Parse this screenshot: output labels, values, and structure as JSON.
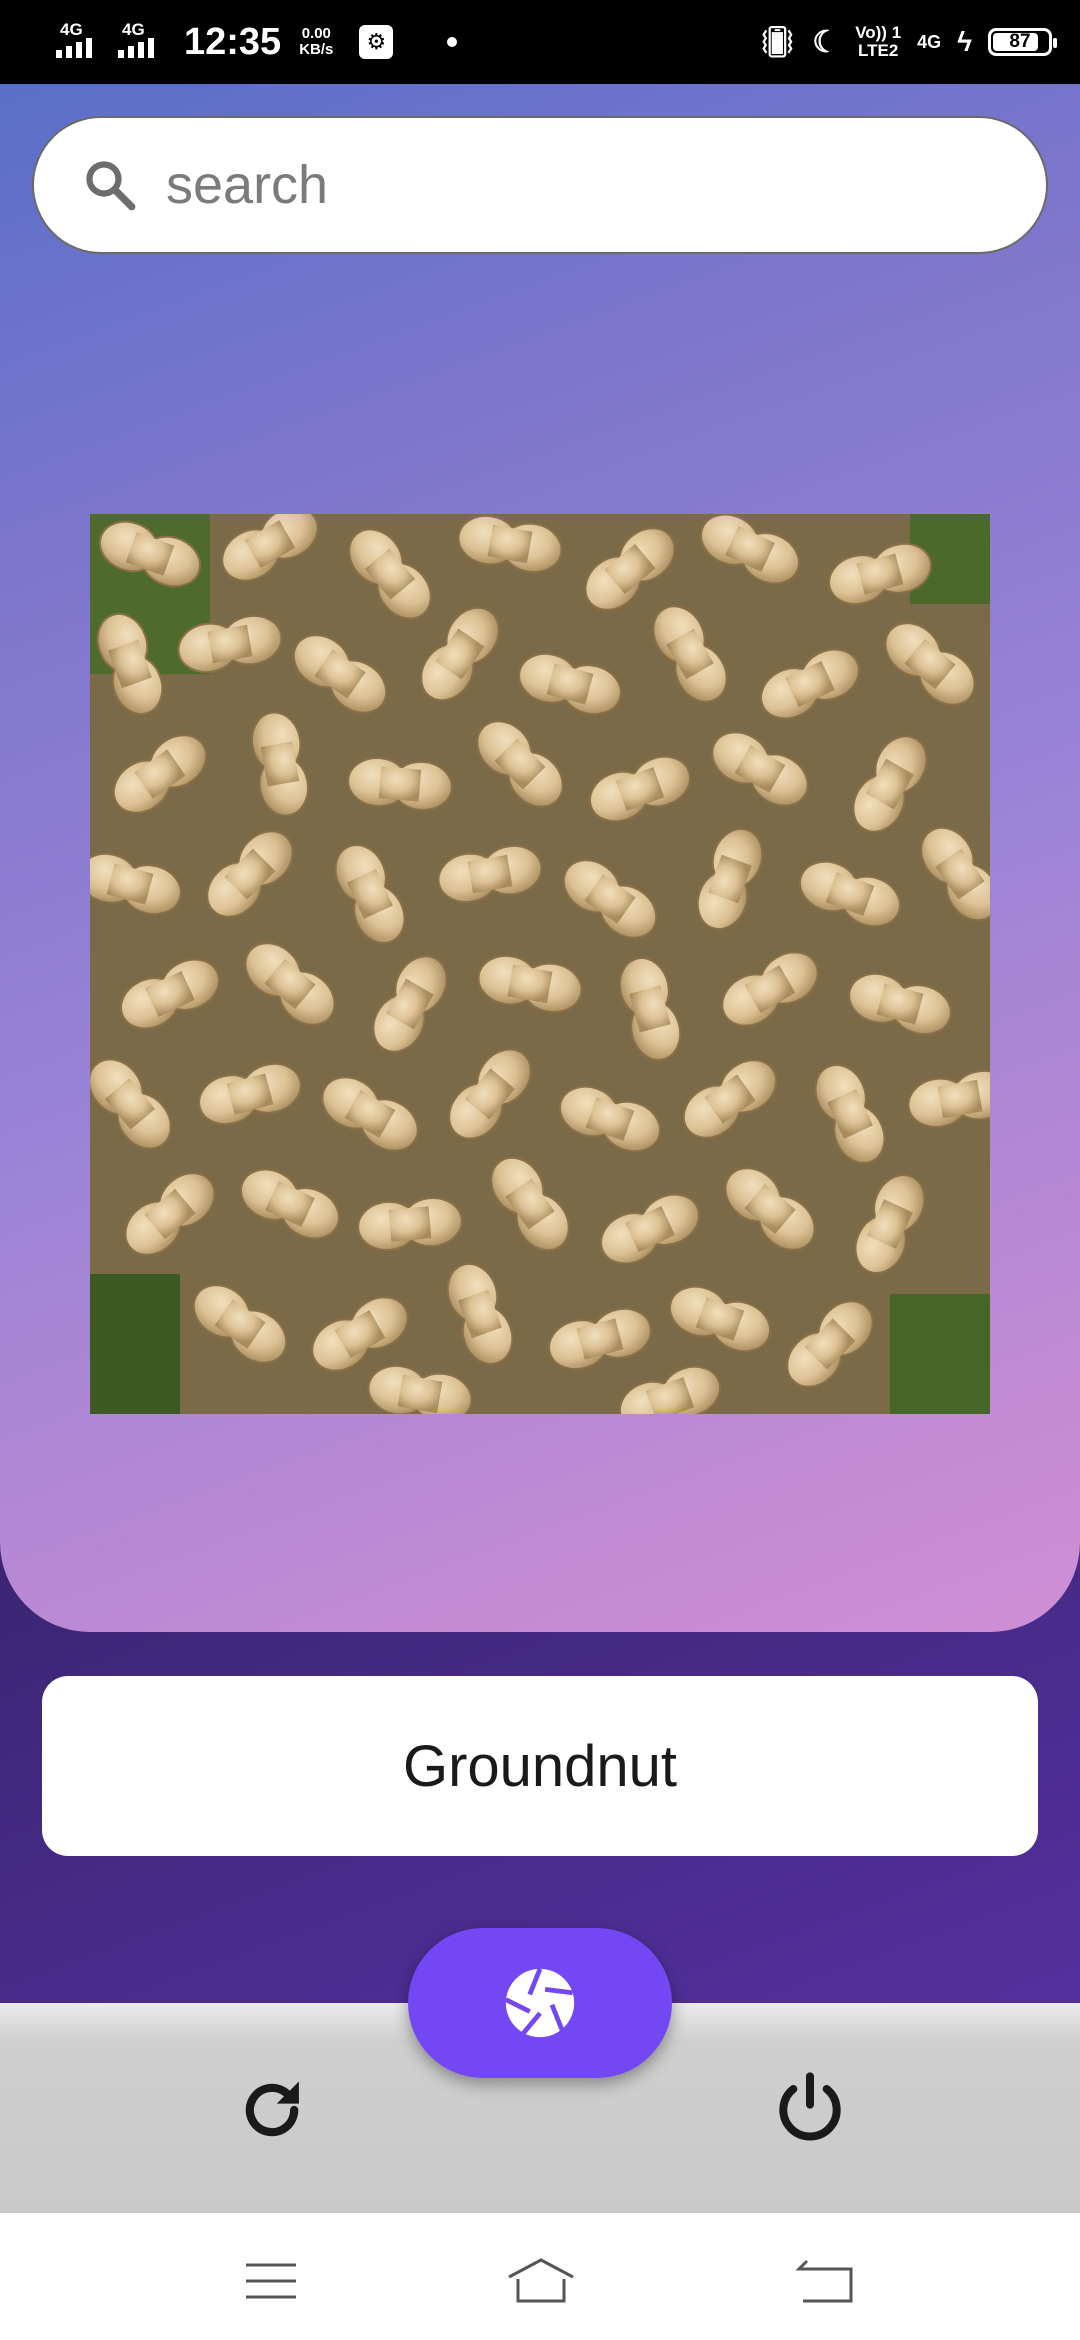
{
  "status_bar": {
    "network1": "4G",
    "network2": "4G",
    "time": "12:35",
    "speed_value": "0.00",
    "speed_unit": "KB/s",
    "volte": "Vo)) 1",
    "lte": "LTE2",
    "network3": "4G",
    "battery": "87"
  },
  "search": {
    "placeholder": "search"
  },
  "result": {
    "label": "Groundnut"
  },
  "colors": {
    "accent": "#7447f4"
  }
}
